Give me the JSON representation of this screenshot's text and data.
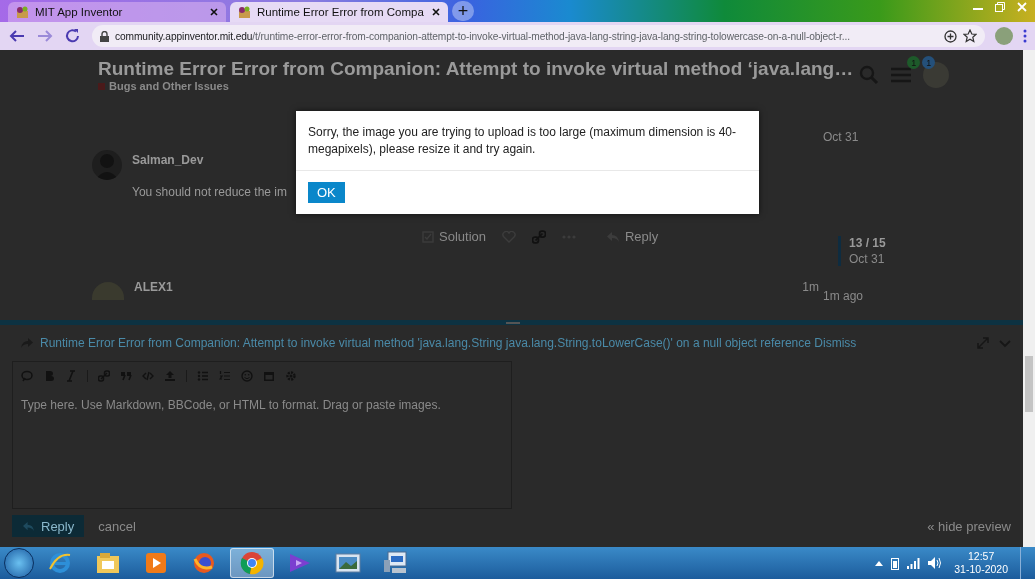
{
  "browser": {
    "tabs": [
      {
        "title": "MIT App Inventor",
        "selected": false
      },
      {
        "title": "Runtime Error Error from Compa",
        "selected": true
      }
    ],
    "new_tab": "+",
    "url_host": "community.appinventor.mit.edu",
    "url_path": "/t/runtime-error-error-from-companion-attempt-to-invoke-virtual-method-java-lang-string-java-lang-string-tolowercase-on-a-null-object-r..."
  },
  "topic": {
    "title": "Runtime Error Error from Companion: Attempt to invoke virtual method ‘java.lang…",
    "category": "Bugs and Other Issues",
    "notifications": [
      {
        "count": "1",
        "color": "#1d5a2a"
      },
      {
        "count": "1",
        "color": "#24507a"
      }
    ]
  },
  "top_date": "Oct 31",
  "post": {
    "author": "Salman_Dev",
    "text": "You should not reduce the im",
    "actions": [
      "Solution",
      "Reply"
    ]
  },
  "timeline": {
    "position": "13 / 15",
    "date": "Oct 31",
    "last": "1m ago"
  },
  "next_post": {
    "author": "ALEX1",
    "age": "1m"
  },
  "composer": {
    "reply_to": "Runtime Error Error from Companion: Attempt to invoke virtual method 'java.lang.String java.lang.String.toLowerCase()' on a null object reference",
    "dismiss": "Dismiss",
    "placeholder": "Type here. Use Markdown, BBCode, or HTML to format. Drag or paste images.",
    "submit": "Reply",
    "cancel": "cancel",
    "hide_preview": "« hide preview"
  },
  "modal": {
    "message": "Sorry, the image you are trying to upload is too large (maximum dimension is 40-megapixels), please resize it and try again.",
    "button": "OK"
  },
  "taskbar": {
    "apps": [
      {
        "kind": "ie",
        "selected": false
      },
      {
        "kind": "folder",
        "selected": false
      },
      {
        "kind": "media",
        "selected": false
      },
      {
        "kind": "firefox",
        "selected": false
      },
      {
        "kind": "chrome",
        "selected": true
      },
      {
        "kind": "vs",
        "selected": false
      },
      {
        "kind": "photo",
        "selected": false
      },
      {
        "kind": "network",
        "selected": false
      }
    ],
    "time": "12:57",
    "date": "31-10-2020"
  }
}
